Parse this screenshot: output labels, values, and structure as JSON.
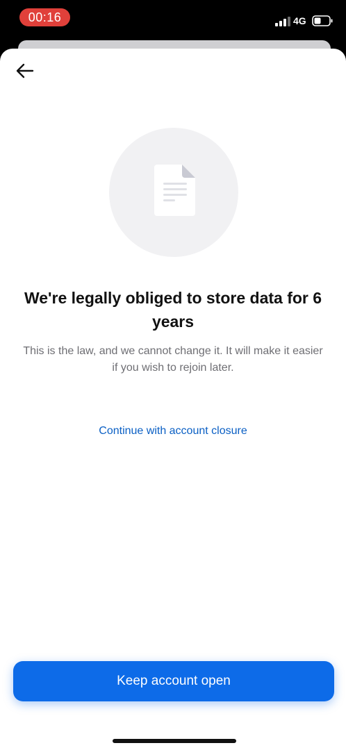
{
  "status_bar": {
    "time": "00:16",
    "network": "4G",
    "icons": [
      "signal-icon",
      "battery-icon"
    ]
  },
  "header": {
    "back_icon": "arrow-left-icon"
  },
  "illustration": {
    "icon": "document-icon"
  },
  "content": {
    "title": "We're legally obliged to store data for 6 years",
    "description": "This is the law, and we cannot change it. It will make it easier if you wish to rejoin later.",
    "continue_link": "Continue with account closure"
  },
  "actions": {
    "primary_label": "Keep account open"
  },
  "colors": {
    "accent": "#0d6be8",
    "link": "#0a5fc4",
    "time_pill": "#e0403a"
  }
}
